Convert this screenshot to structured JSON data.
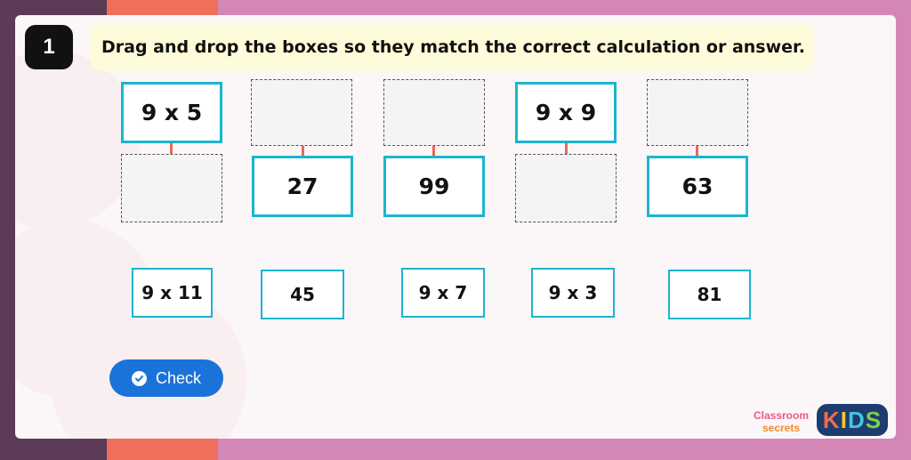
{
  "question": {
    "number": "1",
    "instruction": "Drag and drop the boxes so they match the correct calculation or answer."
  },
  "pairs": [
    {
      "top": "9 x 5",
      "bottom": ""
    },
    {
      "top": "",
      "bottom": "27"
    },
    {
      "top": "",
      "bottom": "99"
    },
    {
      "top": "9 x 9",
      "bottom": ""
    },
    {
      "top": "",
      "bottom": "63"
    }
  ],
  "draggables": [
    "9 x 11",
    "45",
    "9 x 7",
    "9 x 3",
    "81"
  ],
  "check_button": {
    "label": "Check",
    "icon": "check-circle-icon"
  },
  "logo": {
    "classroom_line1": "Classroom",
    "classroom_line2": "secrets",
    "kids": [
      "K",
      "I",
      "D",
      "S"
    ]
  },
  "colors": {
    "card_border": "#1ab5cf",
    "connector": "#e8695a",
    "button": "#1a73d9",
    "instruction_bg": "#fdfbd9"
  }
}
